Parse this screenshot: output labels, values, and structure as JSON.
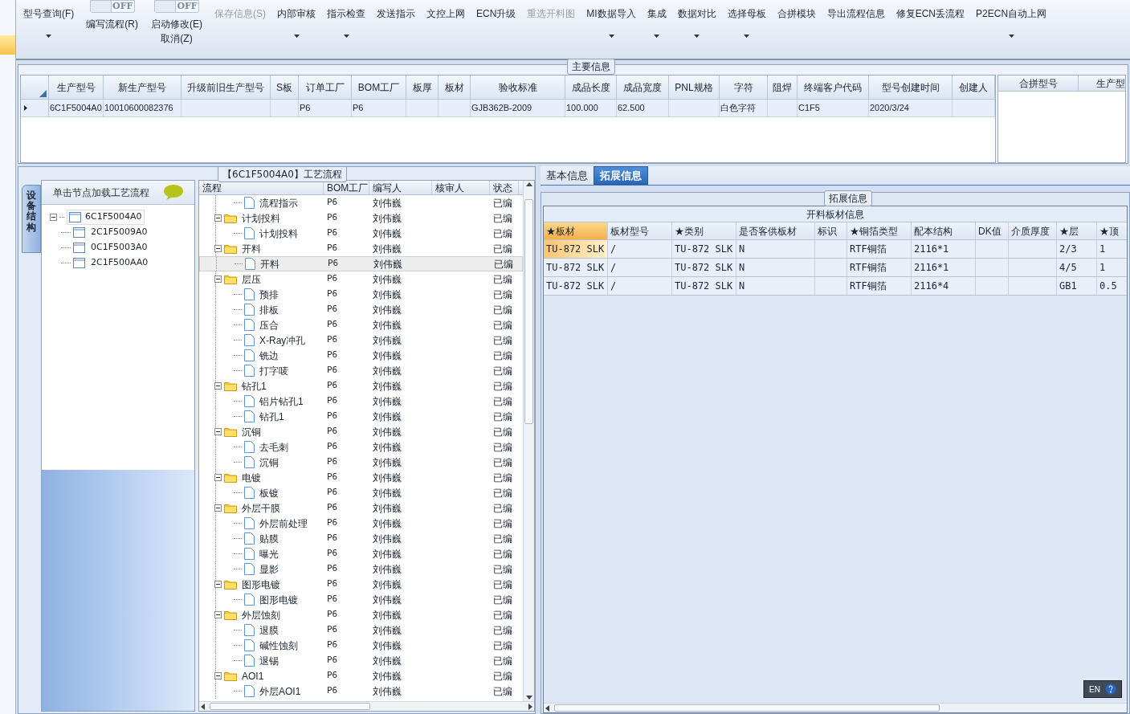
{
  "toolbar": [
    {
      "kind": "button",
      "label": "型号查询(F)",
      "dropdown": true,
      "disabled": false
    },
    {
      "kind": "toggle",
      "label": "编写流程(R)",
      "state_text": "OFF",
      "on": false
    },
    {
      "kind": "toggle",
      "label": "启动修改(E)",
      "state_text": "OFF",
      "on": false,
      "sub_label": "取消(Z)"
    },
    {
      "kind": "button",
      "label": "保存信息(S)",
      "dropdown": false,
      "disabled": true
    },
    {
      "kind": "button",
      "label": "内部审核",
      "dropdown": true,
      "disabled": false
    },
    {
      "kind": "button",
      "label": "指示检查",
      "dropdown": true,
      "disabled": false
    },
    {
      "kind": "button",
      "label": "发送指示",
      "dropdown": false,
      "disabled": false
    },
    {
      "kind": "button",
      "label": "文控上网",
      "dropdown": false,
      "disabled": false
    },
    {
      "kind": "button",
      "label": "ECN升级",
      "dropdown": false,
      "disabled": false
    },
    {
      "kind": "button",
      "label": "重选开料图",
      "dropdown": false,
      "disabled": true
    },
    {
      "kind": "button",
      "label": "MI数据导入",
      "dropdown": true,
      "disabled": false
    },
    {
      "kind": "button",
      "label": "集成",
      "dropdown": true,
      "disabled": false
    },
    {
      "kind": "button",
      "label": "数据对比",
      "dropdown": true,
      "disabled": false
    },
    {
      "kind": "button",
      "label": "选择母板",
      "dropdown": true,
      "disabled": false
    },
    {
      "kind": "button",
      "label": "合拼模块",
      "dropdown": false,
      "disabled": false
    },
    {
      "kind": "button",
      "label": "导出流程信息",
      "dropdown": false,
      "disabled": false
    },
    {
      "kind": "button",
      "label": "修复ECN丢流程",
      "dropdown": false,
      "disabled": false
    },
    {
      "kind": "button",
      "label": "P2ECN自动上网",
      "dropdown": true,
      "disabled": false
    }
  ],
  "main_info": {
    "title": "主要信息",
    "columns": [
      "生产型号",
      "新生产型号",
      "升级前旧生产型号",
      "S板",
      "订单工厂",
      "BOM工厂",
      "板厚",
      "板材",
      "验收标准",
      "成品长度",
      "成品宽度",
      "PNL规格",
      "字符",
      "阻焊",
      "终端客户代码",
      "型号创建时间",
      "创建人"
    ],
    "rows": [
      [
        "6C1F5004A0",
        "10010600082376",
        "",
        "",
        "P6",
        "P6",
        "",
        "",
        "GJB362B-2009",
        "100.000",
        "62.500",
        "",
        "白色字符",
        "",
        "C1F5",
        "2020/3/24",
        ""
      ]
    ],
    "side_columns": [
      "合拼型号",
      "生产型"
    ]
  },
  "side_tab": "设备结构",
  "structure": {
    "hint": "单击节点加载工艺流程",
    "nodes": [
      {
        "label": "6C1F5004A0",
        "expanded": true,
        "children": [
          {
            "label": "2C1F5009A0"
          },
          {
            "label": "0C1F5003A0"
          },
          {
            "label": "2C1F500AA0"
          }
        ]
      }
    ]
  },
  "process": {
    "title": "【6C1F5004A0】工艺流程",
    "columns": [
      "流程",
      "BOM工厂",
      "编写人",
      "核审人",
      "状态"
    ],
    "steps": [
      {
        "name": "流程指示",
        "bom": "P6",
        "writer": "刘伟巍",
        "status": "已编",
        "selected": false
      },
      {
        "name": "计划投料",
        "bom": "P6",
        "writer": "刘伟巍",
        "status": "已编",
        "selected": false,
        "children": [
          {
            "name": "计划投料",
            "bom": "P6",
            "writer": "刘伟巍",
            "status": "已编",
            "selected": false
          }
        ]
      },
      {
        "name": "开料",
        "bom": "P6",
        "writer": "刘伟巍",
        "status": "已编",
        "selected": false,
        "children": [
          {
            "name": "开料",
            "bom": "P6",
            "writer": "刘伟巍",
            "status": "已编",
            "selected": true
          }
        ]
      },
      {
        "name": "层压",
        "bom": "P6",
        "writer": "刘伟巍",
        "status": "已编",
        "selected": false,
        "children": [
          {
            "name": "预排",
            "bom": "P6",
            "writer": "刘伟巍",
            "status": "已编",
            "selected": false
          },
          {
            "name": "排板",
            "bom": "P6",
            "writer": "刘伟巍",
            "status": "已编",
            "selected": false
          },
          {
            "name": "压合",
            "bom": "P6",
            "writer": "刘伟巍",
            "status": "已编",
            "selected": false
          },
          {
            "name": "X-Ray冲孔",
            "bom": "P6",
            "writer": "刘伟巍",
            "status": "已编",
            "selected": false
          },
          {
            "name": "铣边",
            "bom": "P6",
            "writer": "刘伟巍",
            "status": "已编",
            "selected": false
          },
          {
            "name": "打字唛",
            "bom": "P6",
            "writer": "刘伟巍",
            "status": "已编",
            "selected": false
          }
        ]
      },
      {
        "name": "钻孔1",
        "bom": "P6",
        "writer": "刘伟巍",
        "status": "已编",
        "selected": false,
        "children": [
          {
            "name": "铝片钻孔1",
            "bom": "P6",
            "writer": "刘伟巍",
            "status": "已编",
            "selected": false
          },
          {
            "name": "钻孔1",
            "bom": "P6",
            "writer": "刘伟巍",
            "status": "已编",
            "selected": false
          }
        ]
      },
      {
        "name": "沉铜",
        "bom": "P6",
        "writer": "刘伟巍",
        "status": "已编",
        "selected": false,
        "children": [
          {
            "name": "去毛刺",
            "bom": "P6",
            "writer": "刘伟巍",
            "status": "已编",
            "selected": false
          },
          {
            "name": "沉铜",
            "bom": "P6",
            "writer": "刘伟巍",
            "status": "已编",
            "selected": false
          }
        ]
      },
      {
        "name": "电镀",
        "bom": "P6",
        "writer": "刘伟巍",
        "status": "已编",
        "selected": false,
        "children": [
          {
            "name": "板镀",
            "bom": "P6",
            "writer": "刘伟巍",
            "status": "已编",
            "selected": false
          }
        ]
      },
      {
        "name": "外层干膜",
        "bom": "P6",
        "writer": "刘伟巍",
        "status": "已编",
        "selected": false,
        "children": [
          {
            "name": "外层前处理",
            "bom": "P6",
            "writer": "刘伟巍",
            "status": "已编",
            "selected": false
          },
          {
            "name": "贴膜",
            "bom": "P6",
            "writer": "刘伟巍",
            "status": "已编",
            "selected": false
          },
          {
            "name": "曝光",
            "bom": "P6",
            "writer": "刘伟巍",
            "status": "已编",
            "selected": false
          },
          {
            "name": "显影",
            "bom": "P6",
            "writer": "刘伟巍",
            "status": "已编",
            "selected": false
          }
        ]
      },
      {
        "name": "图形电镀",
        "bom": "P6",
        "writer": "刘伟巍",
        "status": "已编",
        "selected": false,
        "children": [
          {
            "name": "图形电镀",
            "bom": "P6",
            "writer": "刘伟巍",
            "status": "已编",
            "selected": false
          }
        ]
      },
      {
        "name": "外层蚀刻",
        "bom": "P6",
        "writer": "刘伟巍",
        "status": "已编",
        "selected": false,
        "children": [
          {
            "name": "退膜",
            "bom": "P6",
            "writer": "刘伟巍",
            "status": "已编",
            "selected": false
          },
          {
            "name": "碱性蚀刻",
            "bom": "P6",
            "writer": "刘伟巍",
            "status": "已编",
            "selected": false
          },
          {
            "name": "退锡",
            "bom": "P6",
            "writer": "刘伟巍",
            "status": "已编",
            "selected": false
          }
        ]
      },
      {
        "name": "AOI1",
        "bom": "P6",
        "writer": "刘伟巍",
        "status": "已编",
        "selected": false,
        "children": [
          {
            "name": "外层AOI1",
            "bom": "P6",
            "writer": "刘伟巍",
            "status": "已编",
            "selected": false
          }
        ]
      }
    ]
  },
  "detail_tabs": [
    {
      "label": "基本信息",
      "selected": false
    },
    {
      "label": "拓展信息",
      "selected": true
    }
  ],
  "extended": {
    "title": "拓展信息",
    "table_title": "开料板材信息",
    "columns": [
      "★板材",
      "板材型号",
      "★类别",
      "是否客供板材",
      "标识",
      "★铜箔类型",
      "配本结构",
      "DK值",
      "介质厚度",
      "★层",
      "★顶"
    ],
    "rows": [
      {
        "selected": true,
        "cells": [
          "TU-872 SLK",
          "/",
          "TU-872 SLK",
          "N",
          "",
          "RTF铜箔",
          "2116*1",
          "",
          "",
          "2/3",
          "1"
        ]
      },
      {
        "selected": false,
        "cells": [
          "TU-872 SLK",
          "/",
          "TU-872 SLK",
          "N",
          "",
          "RTF铜箔",
          "2116*1",
          "",
          "",
          "4/5",
          "1"
        ]
      },
      {
        "selected": false,
        "cells": [
          "TU-872 SLK",
          "/",
          "TU-872 SLK",
          "N",
          "",
          "RTF铜箔",
          "2116*4",
          "",
          "",
          "GB1",
          "0.5"
        ]
      }
    ]
  },
  "ime": {
    "label": "EN"
  }
}
